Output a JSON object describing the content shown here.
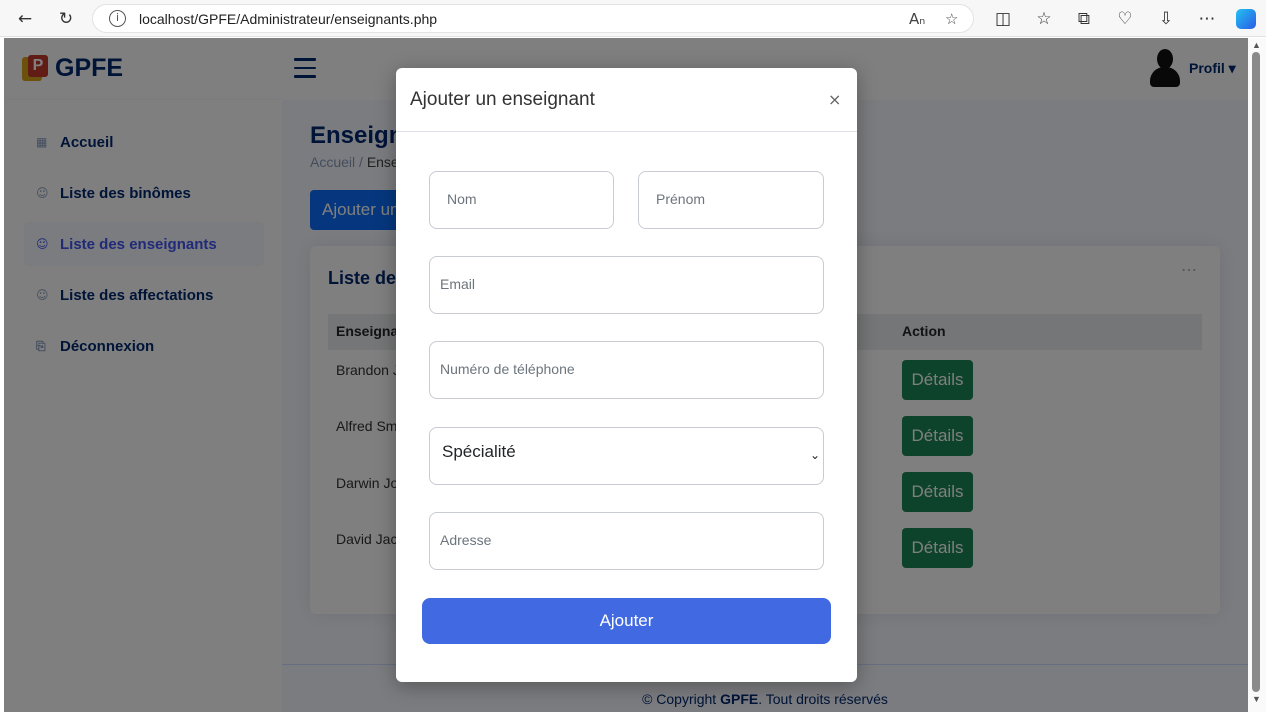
{
  "browser": {
    "url": "localhost/GPFE/Administrateur/enseignants.php"
  },
  "header": {
    "logo_text": "GPFE",
    "logo_letter": "P",
    "profile_label": "Profil ▾"
  },
  "sidebar": {
    "items": [
      {
        "label": "Accueil",
        "icon": "▦"
      },
      {
        "label": "Liste des binômes",
        "icon": "☺"
      },
      {
        "label": "Liste des enseignants",
        "icon": "☺",
        "active": true
      },
      {
        "label": "Liste des affectations",
        "icon": "☺"
      },
      {
        "label": "Déconnexion",
        "icon": "⎘"
      }
    ]
  },
  "main": {
    "title": "Enseignants",
    "breadcrumb_home": "Accueil",
    "breadcrumb_sep": "/",
    "breadcrumb_current": "Enseignants",
    "add_button": "Ajouter un enseignant",
    "card_title": "Liste des enseignants",
    "table": {
      "headers": [
        "Enseignant",
        "Action"
      ],
      "rows": [
        {
          "name": "Brandon Jacob",
          "action": "Détails"
        },
        {
          "name": "Alfred Smith",
          "action": "Détails"
        },
        {
          "name": "Darwin Johnson",
          "action": "Détails"
        },
        {
          "name": "David Jacobs",
          "action": "Détails"
        }
      ]
    }
  },
  "footer": {
    "prefix": "© Copyright ",
    "brand": "GPFE",
    "suffix": ". Tout droits réservés"
  },
  "modal": {
    "title": "Ajouter un enseignant",
    "close": "×",
    "fields": {
      "nom": "Nom",
      "prenom": "Prénom",
      "email": "Email",
      "telephone": "Numéro de téléphone",
      "adresse": "Adresse"
    },
    "specialite": "Spécialité",
    "submit": "Ajouter"
  },
  "colors": {
    "brand": "#012970",
    "primary": "#4169e1",
    "success": "#198754"
  }
}
